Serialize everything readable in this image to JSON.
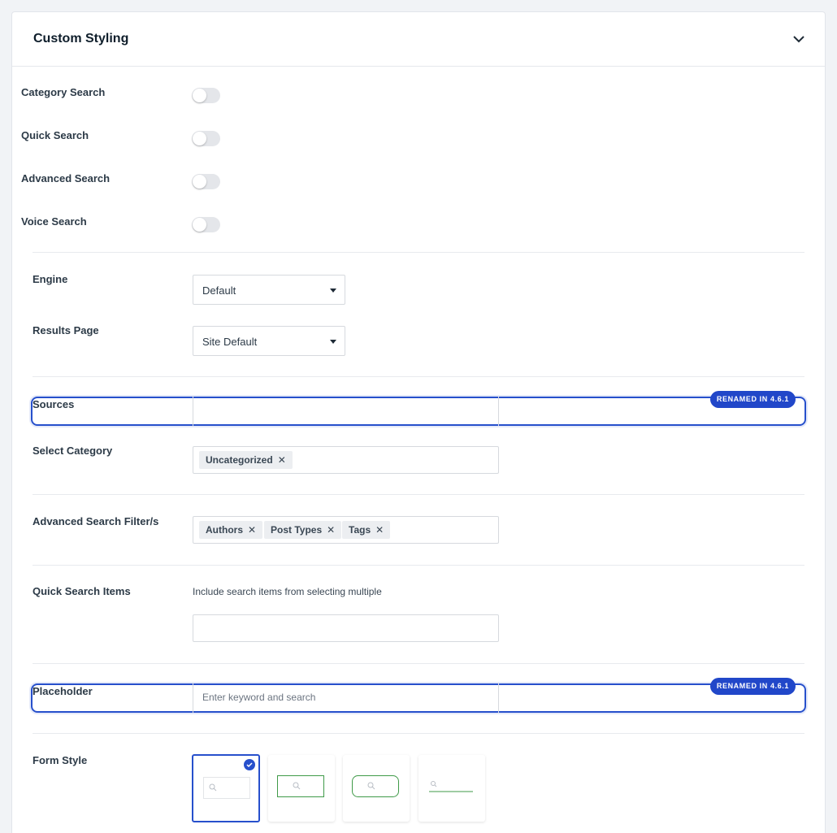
{
  "panel": {
    "title": "Custom Styling"
  },
  "toggles": [
    {
      "label": "Category Search",
      "on": false
    },
    {
      "label": "Quick Search",
      "on": false
    },
    {
      "label": "Advanced Search",
      "on": false
    },
    {
      "label": "Voice Search",
      "on": false
    }
  ],
  "engine": {
    "label": "Engine",
    "value": "Default"
  },
  "results_page": {
    "label": "Results Page",
    "value": "Site Default"
  },
  "sources": {
    "label": "Sources",
    "badge": "RENAMED IN 4.6.1"
  },
  "select_category": {
    "label": "Select Category",
    "tags": [
      "Uncategorized"
    ]
  },
  "advanced_filters": {
    "label": "Advanced Search Filter/s",
    "tags": [
      "Authors",
      "Post Types",
      "Tags"
    ]
  },
  "quick_search_items": {
    "label": "Quick Search Items",
    "hint": "Include search items from selecting multiple",
    "value": ""
  },
  "placeholder": {
    "label": "Placeholder",
    "placeholder": "Enter keyword and search",
    "badge": "RENAMED IN 4.6.1"
  },
  "form_style": {
    "label": "Form Style",
    "selected_index": 0
  },
  "colors": {
    "accent": "#2750cc",
    "green": "#3f9a48",
    "badge_bg": "#2147c9"
  },
  "icons": {
    "collapse": "chevron-down-icon",
    "tag_remove": "close-icon",
    "selected": "check-circle-icon",
    "search": "search-icon"
  }
}
